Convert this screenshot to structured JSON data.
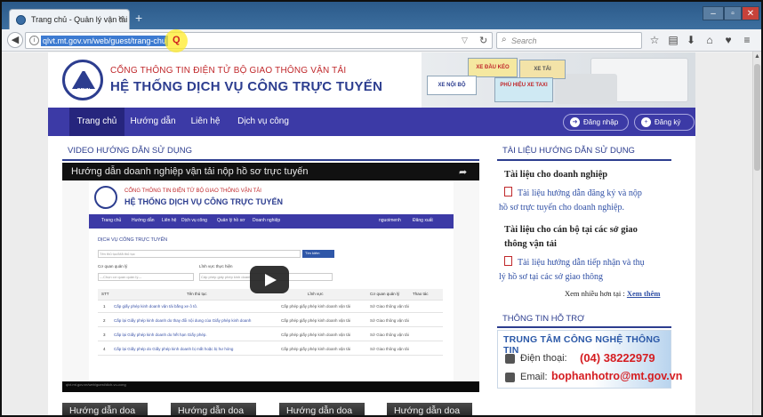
{
  "browser": {
    "tab_title": "Trang chủ - Quản lý vận tải",
    "tab_close": "×",
    "new_tab": "+",
    "url": "qlvt.mt.gov.vn/web/guest/trang-chu",
    "search_placeholder": "Search",
    "window": {
      "minimize": "–",
      "maximize": "▫",
      "close": "✕"
    }
  },
  "site": {
    "top_title": "CỔNG THÔNG TIN ĐIỆN TỬ BỘ GIAO THÔNG VẬN TẢI",
    "main_title": "HỆ THỐNG DỊCH VỤ CÔNG TRỰC TUYẾN",
    "logo_text": "DRVN",
    "banner_cards": [
      "XE ĐẦU KÉO",
      "XE TẢI",
      "XE NỘI BỘ",
      "PHÙ HIỆU XE TAXI"
    ]
  },
  "nav": {
    "items": [
      "Trang chủ",
      "Hướng dẫn",
      "Liên hệ",
      "Dịch vụ công"
    ],
    "login": "Đăng nhập",
    "register": "Đăng ký"
  },
  "video_section": {
    "heading": "VIDEO HƯỚNG DẪN SỬ DỤNG",
    "video_title": "Hướng dẫn doanh nghiệp vận tải nộp hồ sơ trực tuyến",
    "embedded": {
      "top_title": "CỔNG THÔNG TIN ĐIỆN TỬ BỘ GIAO THÔNG VẬN TẢI",
      "main_title": "HỆ THỐNG DỊCH VỤ CÔNG TRỰC TUYẾN",
      "nav": [
        "Trang chủ",
        "Hướng dẫn",
        "Liên hệ",
        "Dịch vụ công",
        "Quản lý hồ sơ",
        "Doanh nghiệp"
      ],
      "user": "nguoimenh",
      "logout": "Đăng xuất",
      "section": "DỊCH VỤ CÔNG TRỰC TUYẾN",
      "search_placeholder": "Tên thủ tục/Mã thủ tục",
      "search_button": "Tìm kiếm",
      "filter1_label": "Cơ quan quản lý",
      "filter1_value": "---Chọn cơ quan quản lý---",
      "filter2_label": "Lĩnh vực thực hiện",
      "filter2_value": "Cấp phép giấy phép kinh doanh",
      "columns": [
        "STT",
        "Tên thủ tục",
        "Lĩnh vực",
        "Cơ quan quản lý",
        "Thao tác"
      ],
      "rows": [
        [
          "1",
          "Cấp giấy phép kinh doanh vận tải bằng xe ô tô.",
          "Cấp phép giấy phép kinh doanh vận tải",
          "Sở Giao thông vận tải"
        ],
        [
          "2",
          "Cấp lại Giấy phép kinh doanh do thay đổi nội dung của Giấy phép kinh doanh",
          "Cấp phép giấy phép kinh doanh vận tải",
          "Sở Giao thông vận tải"
        ],
        [
          "3",
          "Cấp lại Giấy phép kinh doanh do hết hạn Giấy phép.",
          "Cấp phép giấy phép kinh doanh vận tải",
          "Sở Giao thông vận tải"
        ],
        [
          "4",
          "Cấp lại Giấy phép do Giấy phép kinh doanh bị mất hoặc bị hư hỏng",
          "Cấp phép giấy phép kinh doanh vận tải",
          "Sở Giao thông vận tải"
        ]
      ],
      "status_url": "qlvt.mt.gov.vn/web/guest/dich-vu-cong"
    },
    "thumbnails": [
      "Hướng dẫn doa",
      "Hướng dẫn doa",
      "Hướng dẫn doa",
      "Hướng dẫn doa"
    ]
  },
  "docs": {
    "heading": "TÀI LIỆU HƯỚNG DẪN SỬ DỤNG",
    "group1_title": "Tài liệu cho doanh nghiệp",
    "group1_link_line1": "Tài liệu hướng dẫn đăng ký và nộp",
    "group1_link_line2": "hồ sơ trực tuyến cho doanh nghiệp.",
    "group2_title_line1": "Tài liệu cho cán bộ tại các sở giao",
    "group2_title_line2": "thông vận tải",
    "group2_link_line1": "Tài liệu hướng dẫn tiếp nhận và thụ",
    "group2_link_line2": "lý hồ sơ tại các sở giao thông",
    "more_label": "Xem nhiều hơn tại :",
    "more_link": "Xem thêm"
  },
  "support": {
    "heading": "THÔNG TIN HỖ TRỢ",
    "center": "TRUNG TÂM CÔNG NGHỆ THÔNG TIN",
    "phone_label": "Điện thoại:",
    "phone": "(04) 38222979",
    "email_label": "Email:",
    "email": "bophanhotro@mt.gov.vn"
  },
  "colors": {
    "nav_bg": "#3c3aa6",
    "title_blue": "#2c3d8f",
    "accent_red": "#c0282b",
    "link_blue": "#2f4fa5"
  }
}
